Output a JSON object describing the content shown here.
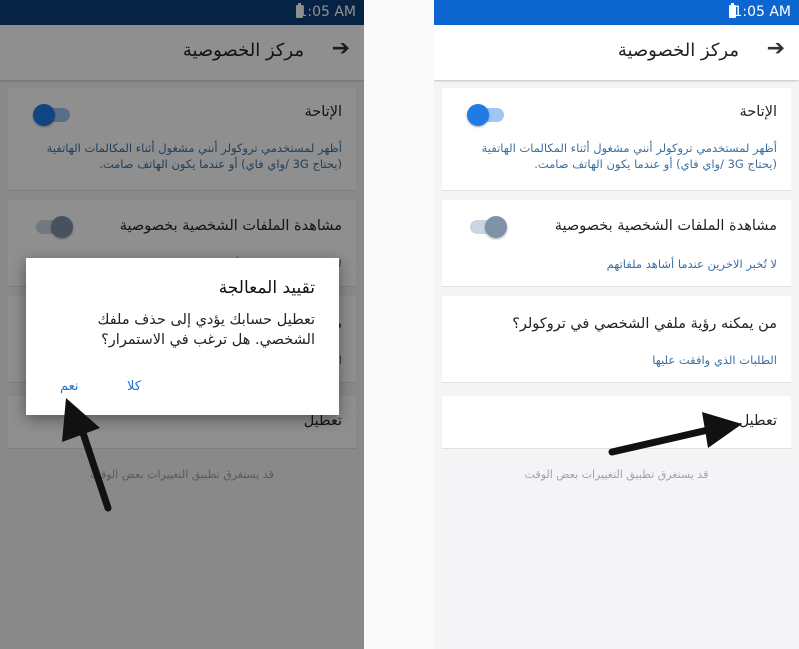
{
  "status_bar": {
    "time": "1:05 AM"
  },
  "app_bar": {
    "title": "مركز الخصوصية",
    "back_icon": "arrow-right-icon"
  },
  "settings": {
    "availability": {
      "title": "الإتاحة",
      "description": "أظهر لمستخدمي تروكولر أنني مشغول أثناء المكالمات الهاتفية (يحتاج 3G /واي فاي) أو عندما يكون الهاتف صامت.",
      "toggle_on": true
    },
    "private_viewing": {
      "title": "مشاهدة الملفات الشخصية بخصوصية",
      "description": "لا تُخبر الاخرين عندما أشاهد ملفاتهم",
      "toggle_on": false
    },
    "who_can_view": {
      "title": "من يمكنه رؤية ملفي الشخصي في تروكولر؟",
      "description": "الطلبات الذي وافقت عليها"
    },
    "deactivate": {
      "title": "تعطيل"
    },
    "note": "قد يستغرق تطبيق التغييرات بعض الوقت"
  },
  "dialog": {
    "title": "تقييد المعالجة",
    "body": "تعطيل حسابك يؤدي إلى حذف ملفك الشخصي. هل ترغب في الاستمرار؟",
    "yes_label": "نعم",
    "no_label": "كلا"
  },
  "colors": {
    "status_bar_left": "#0b3f7e",
    "status_bar_right": "#0d66d0",
    "accent": "#1f7be6",
    "link_text": "#3b6fa3",
    "annotation_arrow": "#111111"
  }
}
